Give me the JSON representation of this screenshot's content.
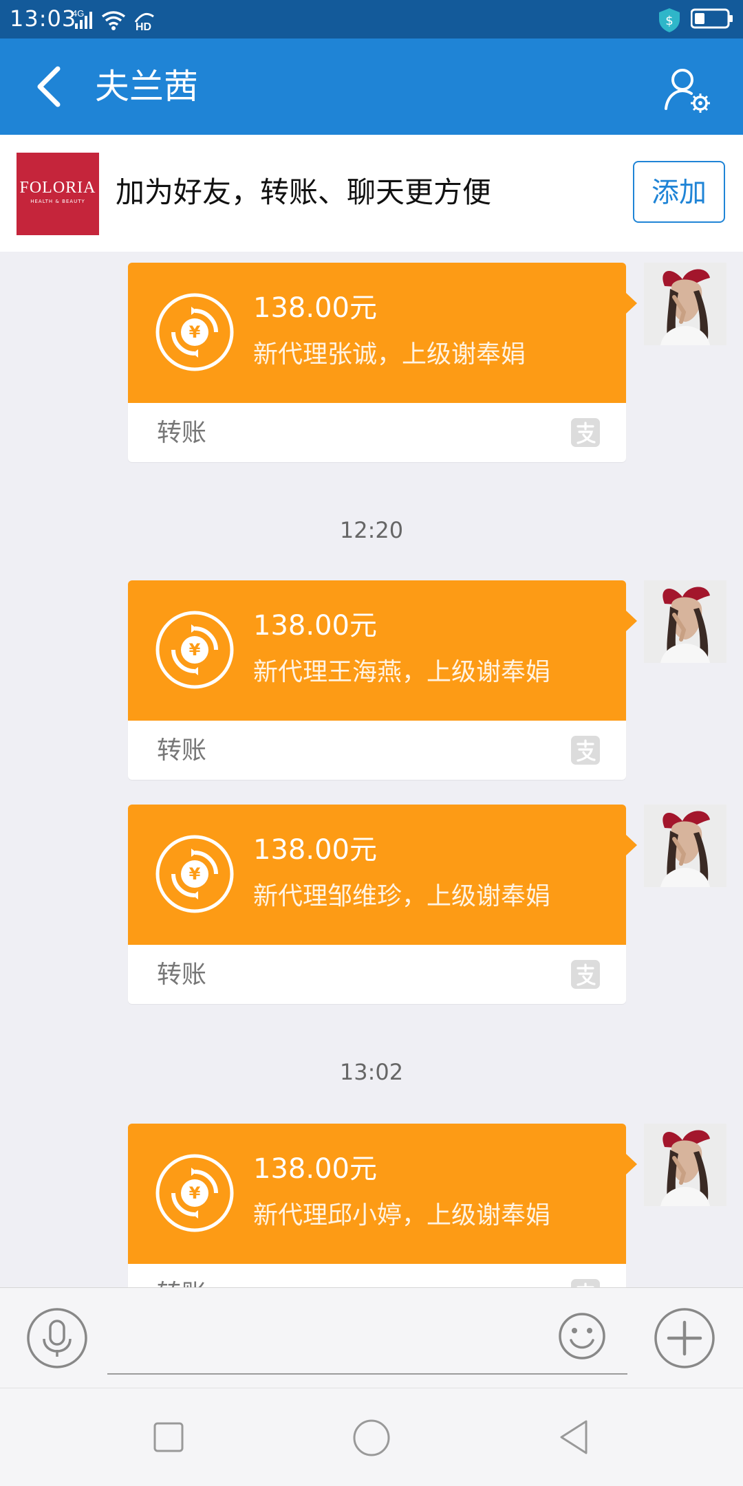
{
  "status_bar": {
    "time": "13:03",
    "network": "4G",
    "hd_label": "HD"
  },
  "header": {
    "title": "夫兰茜"
  },
  "add_friend_bar": {
    "logo_text": "FOLORIA",
    "logo_subtext": "HEALTH & BEAUTY",
    "prompt": "加为好友，转账、聊天更方便",
    "add_button": "添加"
  },
  "messages": [
    {
      "type": "transfer",
      "amount": "138.00元",
      "description": "新代理张诚，上级谢奉娟",
      "label": "转账"
    },
    {
      "type": "timestamp",
      "text": "12:20"
    },
    {
      "type": "transfer",
      "amount": "138.00元",
      "description": "新代理王海燕，上级谢奉娟",
      "label": "转账"
    },
    {
      "type": "transfer",
      "amount": "138.00元",
      "description": "新代理邹维珍，上级谢奉娟",
      "label": "转账"
    },
    {
      "type": "timestamp",
      "text": "13:02"
    },
    {
      "type": "transfer",
      "amount": "138.00元",
      "description": "新代理邱小婷，上级谢奉娟",
      "label": "转账"
    }
  ],
  "colors": {
    "status_bar": "#135a9a",
    "header": "#1f84d6",
    "transfer_card": "#fd9b15",
    "background": "#efeff4"
  },
  "icons": {
    "back": "chevron-left-icon",
    "profile_settings": "user-gear-icon",
    "coin": "yuan-transfer-icon",
    "payment": "alipay-icon",
    "voice": "microphone-icon",
    "emoji": "smiley-icon",
    "more": "plus-icon"
  }
}
